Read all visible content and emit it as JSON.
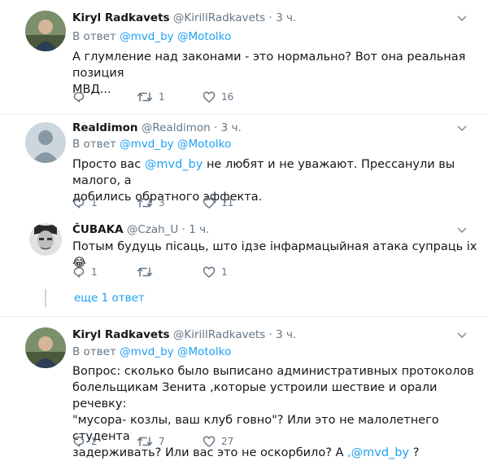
{
  "tweets": [
    {
      "name": "Kiryl Radkavets",
      "handle": "@KirillRadkavets",
      "time": "· 3 ч.",
      "reply_prefix": "В ответ",
      "reply_to_1": "@mvd_by",
      "reply_to_2": "@Motolko",
      "text_line1": "А глумление над законами - это нормально? Вот она реальная позиция",
      "text_line2": "МВД...",
      "reply_count": "",
      "retweet_count": "1",
      "like_count": "16"
    },
    {
      "name": "Realdimon",
      "handle": "@Realdimon",
      "time": "· 3 ч.",
      "reply_prefix": "В ответ",
      "reply_to_1": "@mvd_by",
      "reply_to_2": "@Motolko",
      "text_pre": "Просто вас ",
      "text_mention": "@mvd_by",
      "text_post": " не любят и не уважают. Прессанули вы малого, а",
      "text_line2": "добились обратного эффекта.",
      "reply_count": "1",
      "retweet_count": "3",
      "like_count": "11"
    },
    {
      "name": "ČUBAKA",
      "handle": "@Czah_U",
      "time": "· 1 ч.",
      "text_line1": "Потым будуць пісаць, што ідзе інфармацыйная атака супраць іх 😂",
      "reply_count": "1",
      "retweet_count": "",
      "like_count": "1"
    },
    {
      "name": "Kiryl Radkavets",
      "handle": "@KirillRadkavets",
      "time": "· 3 ч.",
      "reply_prefix": "В ответ",
      "reply_to_1": "@mvd_by",
      "reply_to_2": "@Motolko",
      "text_line1": "Вопрос: сколько было выписано административных протоколов",
      "text_line2": "болельщикам Зенита ,которые устроили шествие и орали речевку:",
      "text_line3": "\"мусора- козлы, ваш клуб говно\"? Или это не малолетнего студента",
      "text_line4_pre": "задерживать? Или вас это не оскорбило? А ",
      "text_line4_mention": ",@mvd_by",
      "text_line4_post": " ?",
      "reply_count": "2",
      "retweet_count": "7",
      "like_count": "27"
    }
  ],
  "more_replies_label": "еще 1 ответ",
  "icons": {
    "reply": "reply-icon",
    "retweet": "retweet-icon",
    "like": "heart-icon",
    "caret": "chevron-down-icon"
  },
  "colors": {
    "link": "#1da1f2",
    "muted": "#657786",
    "text": "#14171a",
    "divider": "#e6ecf0"
  }
}
